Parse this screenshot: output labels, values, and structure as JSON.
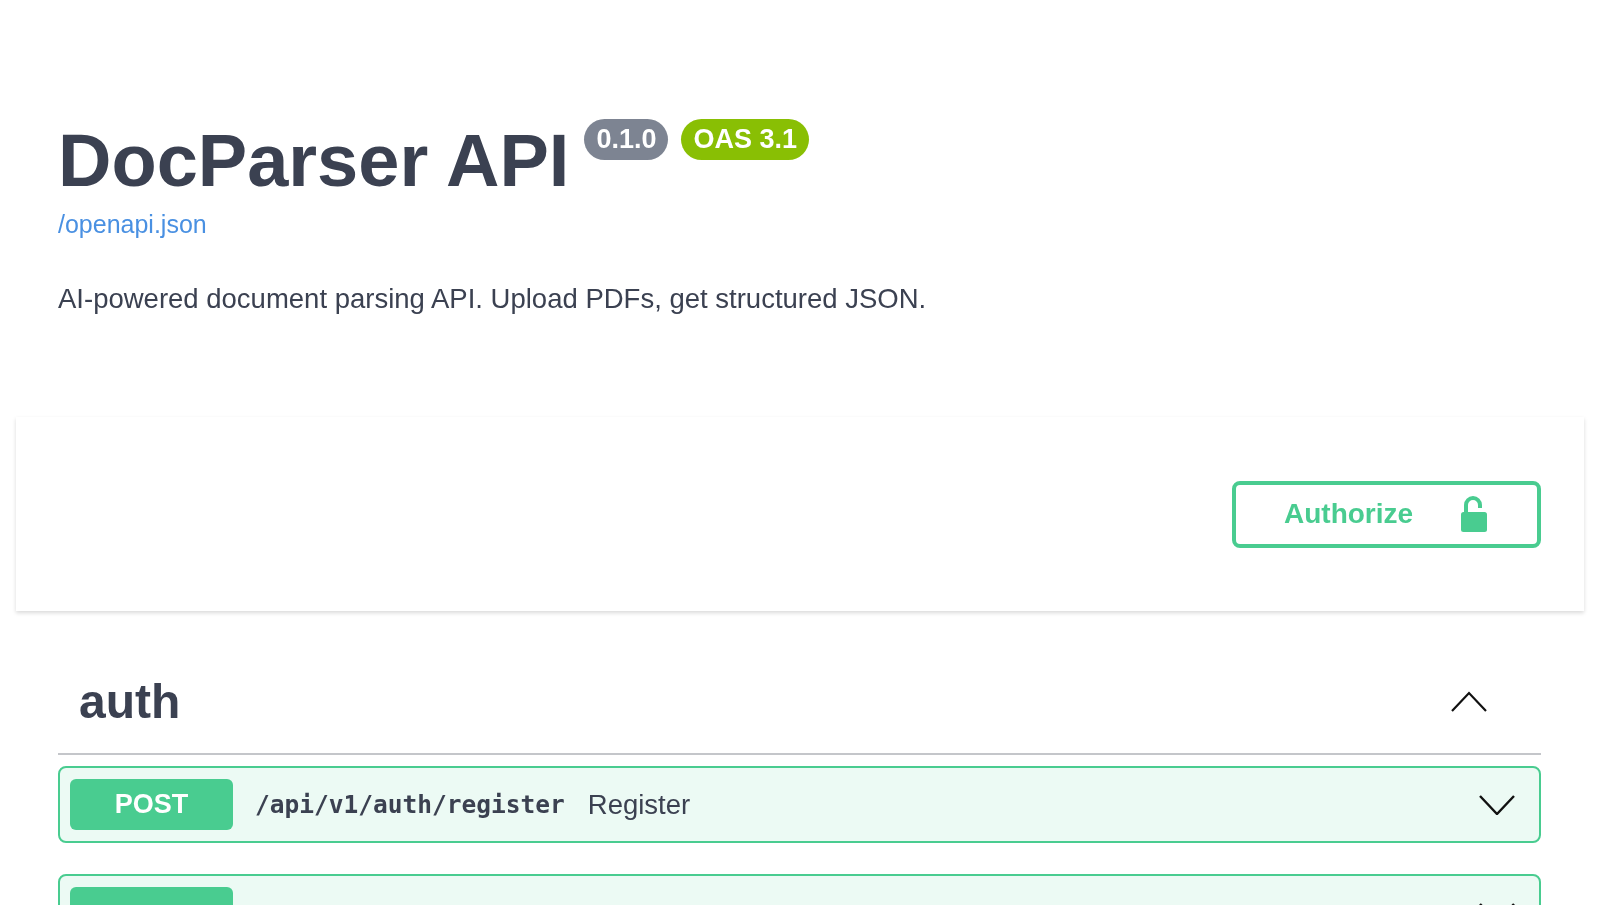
{
  "info": {
    "title": "DocParser API",
    "version": "0.1.0",
    "oas_version": "OAS 3.1",
    "spec_link": "/openapi.json",
    "description": "AI-powered document parsing API. Upload PDFs, get structured JSON."
  },
  "authorize": {
    "label": "Authorize",
    "locked": false
  },
  "tags": [
    {
      "name": "auth",
      "expanded": true,
      "operations": [
        {
          "kind": "post",
          "method": "POST",
          "path": "/api/v1/auth/register",
          "summary": "Register",
          "expanded": false
        },
        {
          "kind": "post",
          "expanded": false
        }
      ]
    }
  ]
}
